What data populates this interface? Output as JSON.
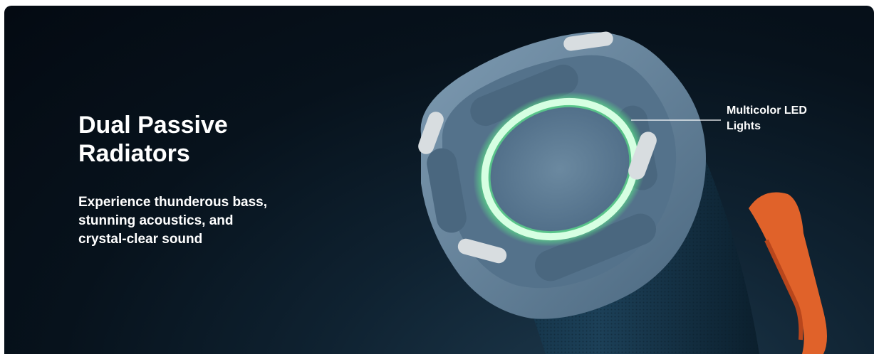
{
  "feature": {
    "title": "Dual Passive\nRadiators",
    "description": "Experience thunderous bass,\nstunning acoustics, and\ncrystal-clear sound"
  },
  "callout": {
    "label": "Multicolor LED\nLights"
  },
  "colors": {
    "background": "#07121c",
    "speaker_body": "#5f7f99",
    "led_glow": "#5cf08a",
    "strap": "#e0622a",
    "text": "#ffffff"
  }
}
